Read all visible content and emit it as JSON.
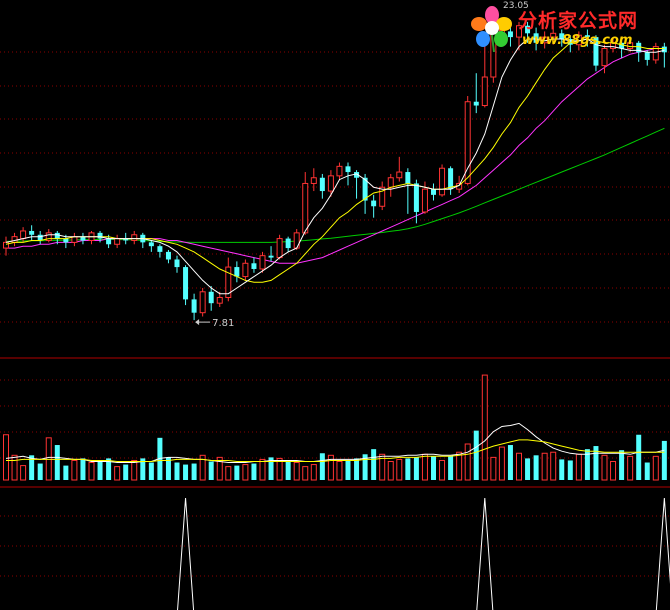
{
  "logo": {
    "main_text": "分析家公式网",
    "url_text": "www.88gs.com"
  },
  "colors": {
    "background": "#000000",
    "up_candle": "#ff3333",
    "down_candle": "#54ffff",
    "ma5": "#ffffff",
    "ma10": "#ffff00",
    "ma20": "#ff33ff",
    "ma60": "#00cc00",
    "grid": "#8b0000",
    "separator": "#b00000"
  },
  "chart_data": {
    "type": "candlestick",
    "title": "",
    "price_low_label": "7.81",
    "price_high_label": "23.05",
    "price_range": [
      6.5,
      23.6
    ],
    "candles": [
      [
        11.6,
        11.9,
        12.2,
        11.2
      ],
      [
        11.9,
        12.2,
        12.4,
        11.7
      ],
      [
        12.1,
        12.5,
        12.7,
        11.9
      ],
      [
        12.5,
        12.3,
        12.8,
        12.0
      ],
      [
        12.3,
        12.0,
        12.5,
        11.8
      ],
      [
        12.0,
        12.4,
        12.6,
        11.9
      ],
      [
        12.4,
        12.1,
        12.5,
        11.8
      ],
      [
        12.1,
        11.9,
        12.3,
        11.6
      ],
      [
        11.9,
        12.2,
        12.4,
        11.7
      ],
      [
        12.2,
        12.0,
        12.4,
        11.8
      ],
      [
        12.0,
        12.4,
        12.5,
        11.8
      ],
      [
        12.4,
        12.1,
        12.5,
        11.9
      ],
      [
        12.1,
        11.8,
        12.3,
        11.6
      ],
      [
        11.8,
        12.1,
        12.3,
        11.6
      ],
      [
        12.1,
        12.0,
        12.4,
        11.8
      ],
      [
        12.0,
        12.3,
        12.5,
        11.8
      ],
      [
        12.3,
        11.9,
        12.4,
        11.6
      ],
      [
        11.9,
        11.7,
        12.0,
        11.4
      ],
      [
        11.7,
        11.4,
        11.8,
        11.1
      ],
      [
        11.4,
        11.0,
        11.5,
        10.8
      ],
      [
        11.0,
        10.6,
        11.2,
        10.3
      ],
      [
        10.6,
        8.9,
        10.7,
        8.6
      ],
      [
        8.9,
        8.2,
        9.2,
        7.81
      ],
      [
        8.2,
        9.3,
        9.5,
        8.0
      ],
      [
        9.3,
        8.7,
        9.6,
        8.3
      ],
      [
        8.7,
        9.0,
        9.3,
        8.5
      ],
      [
        9.0,
        10.6,
        11.1,
        8.8
      ],
      [
        10.6,
        10.1,
        10.9,
        9.8
      ],
      [
        10.1,
        10.8,
        11.0,
        9.9
      ],
      [
        10.8,
        10.5,
        11.1,
        10.3
      ],
      [
        10.5,
        11.2,
        11.4,
        10.3
      ],
      [
        11.2,
        11.1,
        11.7,
        10.9
      ],
      [
        11.1,
        12.1,
        12.3,
        11.0
      ],
      [
        12.1,
        11.6,
        12.2,
        11.4
      ],
      [
        11.6,
        12.4,
        12.6,
        11.5
      ],
      [
        12.4,
        15.0,
        15.6,
        12.3
      ],
      [
        15.0,
        15.3,
        15.8,
        14.6
      ],
      [
        15.3,
        14.6,
        15.5,
        14.2
      ],
      [
        14.6,
        15.4,
        15.7,
        14.3
      ],
      [
        15.4,
        15.9,
        16.1,
        15.2
      ],
      [
        15.9,
        15.6,
        16.1,
        14.9
      ],
      [
        15.6,
        15.3,
        15.7,
        14.2
      ],
      [
        15.3,
        14.1,
        15.5,
        13.4
      ],
      [
        14.1,
        13.8,
        14.4,
        13.2
      ],
      [
        13.8,
        14.8,
        15.1,
        13.6
      ],
      [
        14.8,
        15.3,
        15.5,
        14.3
      ],
      [
        15.3,
        15.6,
        16.4,
        15.1
      ],
      [
        15.6,
        15.0,
        15.8,
        13.4
      ],
      [
        15.0,
        13.5,
        15.2,
        12.9
      ],
      [
        13.5,
        14.7,
        15.1,
        13.4
      ],
      [
        14.7,
        14.4,
        15.0,
        14.1
      ],
      [
        14.4,
        15.8,
        16.0,
        14.3
      ],
      [
        15.8,
        14.7,
        15.9,
        14.4
      ],
      [
        14.7,
        15.0,
        15.4,
        14.5
      ],
      [
        15.0,
        19.3,
        19.6,
        14.9
      ],
      [
        19.3,
        19.1,
        20.8,
        18.7
      ],
      [
        19.1,
        20.6,
        22.4,
        19.0
      ],
      [
        20.6,
        22.9,
        23.3,
        20.3
      ],
      [
        22.9,
        23.05,
        23.4,
        22.4
      ],
      [
        23.0,
        22.7,
        23.6,
        22.2
      ],
      [
        22.7,
        23.3,
        23.5,
        22.0
      ],
      [
        23.3,
        22.9,
        23.5,
        22.4
      ],
      [
        22.9,
        22.4,
        23.2,
        22.0
      ],
      [
        22.4,
        22.7,
        23.0,
        22.1
      ],
      [
        22.7,
        22.9,
        23.3,
        22.3
      ],
      [
        22.9,
        22.6,
        23.1,
        22.2
      ],
      [
        22.6,
        22.3,
        22.8,
        21.9
      ],
      [
        22.3,
        22.8,
        23.0,
        22.0
      ],
      [
        22.8,
        22.7,
        23.1,
        22.2
      ],
      [
        22.7,
        21.2,
        22.8,
        20.9
      ],
      [
        21.2,
        22.1,
        22.3,
        20.8
      ],
      [
        22.1,
        22.4,
        22.6,
        21.9
      ],
      [
        22.4,
        22.1,
        22.5,
        21.6
      ],
      [
        22.1,
        22.4,
        22.7,
        21.9
      ],
      [
        22.4,
        21.9,
        22.5,
        21.4
      ],
      [
        21.9,
        21.5,
        22.0,
        21.2
      ],
      [
        21.5,
        22.2,
        22.4,
        21.3
      ],
      [
        22.2,
        21.9,
        22.4,
        21.1
      ]
    ],
    "volume_range": [
      0,
      105
    ],
    "volumes": [
      44,
      24,
      14,
      24,
      16,
      41,
      34,
      14,
      19,
      21,
      17,
      18,
      21,
      13,
      15,
      19,
      21,
      17,
      41,
      22,
      17,
      15,
      16,
      24,
      18,
      22,
      13,
      14,
      15,
      16,
      20,
      22,
      21,
      18,
      17,
      13,
      15,
      26,
      24,
      18,
      19,
      21,
      25,
      30,
      25,
      18,
      20,
      21,
      22,
      25,
      23,
      19,
      23,
      27,
      35,
      48,
      102,
      22,
      32,
      34,
      26,
      21,
      24,
      26,
      27,
      20,
      19,
      25,
      30,
      33,
      24,
      18,
      29,
      23,
      44,
      17,
      23,
      38
    ],
    "vol_ma1": [
      21,
      22,
      23,
      21,
      20,
      22,
      22,
      21,
      20,
      20,
      18,
      18,
      18,
      17,
      17,
      17,
      18,
      18,
      21,
      22,
      22,
      21,
      20,
      20,
      19,
      18,
      17,
      17,
      17,
      18,
      18,
      19,
      19,
      19,
      19,
      18,
      18,
      19,
      20,
      20,
      20,
      20,
      21,
      22,
      23,
      23,
      23,
      24,
      24,
      25,
      25,
      24,
      24,
      25,
      27,
      32,
      38,
      47,
      52,
      53,
      55,
      49,
      42,
      36,
      31,
      28,
      26,
      25,
      25,
      26,
      26,
      26,
      26,
      25,
      27,
      27,
      27,
      29
    ],
    "vol_ma2": [
      19,
      19,
      20,
      20,
      20,
      20,
      20,
      20,
      20,
      20,
      19,
      19,
      19,
      18,
      18,
      18,
      18,
      18,
      19,
      19,
      20,
      20,
      20,
      20,
      19,
      19,
      19,
      18,
      18,
      18,
      18,
      18,
      18,
      18,
      18,
      18,
      18,
      18,
      19,
      19,
      19,
      19,
      20,
      20,
      21,
      21,
      22,
      22,
      22,
      23,
      23,
      23,
      23,
      24,
      25,
      27,
      30,
      33,
      35,
      37,
      39,
      39,
      38,
      37,
      35,
      33,
      31,
      29,
      28,
      28,
      27,
      27,
      27,
      27,
      27,
      27,
      27,
      27
    ],
    "signals": [
      21,
      56,
      77
    ],
    "ma5": [
      11.9,
      12.0,
      12.1,
      12.2,
      12.2,
      12.3,
      12.3,
      12.2,
      12.2,
      12.2,
      12.2,
      12.2,
      12.1,
      12.1,
      12.1,
      12.1,
      12.1,
      12.0,
      11.9,
      11.7,
      11.4,
      10.9,
      10.4,
      9.9,
      9.5,
      9.2,
      9.2,
      9.5,
      9.8,
      10.1,
      10.4,
      10.7,
      11.1,
      11.4,
      11.6,
      12.5,
      13.2,
      13.7,
      14.4,
      15.2,
      15.4,
      15.5,
      15.2,
      14.8,
      14.7,
      14.7,
      14.8,
      14.9,
      14.9,
      14.8,
      14.7,
      14.7,
      14.7,
      14.9,
      15.8,
      16.6,
      17.6,
      19.1,
      20.6,
      21.5,
      22.2,
      22.6,
      22.6,
      22.5,
      22.6,
      22.6,
      22.5,
      22.5,
      22.6,
      22.3,
      22.2,
      22.2,
      22.1,
      22.0,
      22.0,
      21.9,
      21.9,
      22.0
    ],
    "ma10": [
      11.8,
      11.9,
      11.9,
      12.0,
      12.0,
      12.1,
      12.1,
      12.1,
      12.2,
      12.2,
      12.2,
      12.2,
      12.2,
      12.1,
      12.1,
      12.1,
      12.1,
      12.1,
      12.0,
      11.9,
      11.8,
      11.6,
      11.4,
      11.1,
      10.8,
      10.5,
      10.3,
      10.1,
      9.9,
      9.8,
      9.8,
      9.9,
      10.2,
      10.5,
      10.8,
      11.3,
      11.8,
      12.2,
      12.7,
      13.2,
      13.5,
      13.9,
      14.2,
      14.5,
      14.6,
      14.8,
      14.9,
      15.0,
      14.9,
      14.8,
      14.7,
      14.7,
      14.8,
      14.9,
      15.3,
      15.8,
      16.3,
      16.9,
      17.6,
      18.2,
      19.0,
      19.6,
      20.3,
      21.0,
      21.6,
      22.0,
      22.4,
      22.5,
      22.6,
      22.5,
      22.4,
      22.4,
      22.3,
      22.2,
      22.2,
      22.1,
      22.1,
      22.1
    ],
    "ma20": [
      11.6,
      11.6,
      11.7,
      11.7,
      11.8,
      11.8,
      11.9,
      11.9,
      11.9,
      12.0,
      12.0,
      12.0,
      12.1,
      12.1,
      12.1,
      12.1,
      12.1,
      12.1,
      12.1,
      12.0,
      12.0,
      11.9,
      11.8,
      11.7,
      11.6,
      11.5,
      11.4,
      11.3,
      11.2,
      11.1,
      11.0,
      10.9,
      10.8,
      10.8,
      10.8,
      10.9,
      11.0,
      11.1,
      11.3,
      11.5,
      11.7,
      11.9,
      12.1,
      12.3,
      12.5,
      12.7,
      12.9,
      13.1,
      13.3,
      13.5,
      13.7,
      13.9,
      14.1,
      14.3,
      14.6,
      14.9,
      15.3,
      15.7,
      16.1,
      16.5,
      17.0,
      17.4,
      17.9,
      18.3,
      18.8,
      19.3,
      19.7,
      20.1,
      20.5,
      20.8,
      21.1,
      21.4,
      21.6,
      21.8,
      21.9,
      22.0,
      22.1,
      22.1
    ],
    "ma60": [
      11.95,
      11.96,
      11.97,
      11.98,
      11.99,
      12.0,
      12.01,
      12.02,
      12.03,
      12.04,
      12.05,
      12.05,
      12.05,
      12.05,
      12.04,
      12.03,
      12.0,
      11.97,
      11.95,
      11.93,
      11.92,
      11.91,
      11.9,
      11.9,
      11.9,
      11.9,
      11.9,
      11.9,
      11.9,
      11.9,
      11.9,
      11.9,
      11.92,
      11.94,
      11.97,
      12.0,
      12.04,
      12.08,
      12.12,
      12.17,
      12.22,
      12.27,
      12.32,
      12.37,
      12.42,
      12.48,
      12.54,
      12.62,
      12.72,
      12.85,
      13.0,
      13.15,
      13.3,
      13.45,
      13.62,
      13.8,
      13.98,
      14.16,
      14.34,
      14.52,
      14.7,
      14.88,
      15.06,
      15.24,
      15.42,
      15.6,
      15.78,
      15.96,
      16.14,
      16.32,
      16.5,
      16.7,
      16.9,
      17.1,
      17.3,
      17.5,
      17.7,
      17.9
    ]
  }
}
